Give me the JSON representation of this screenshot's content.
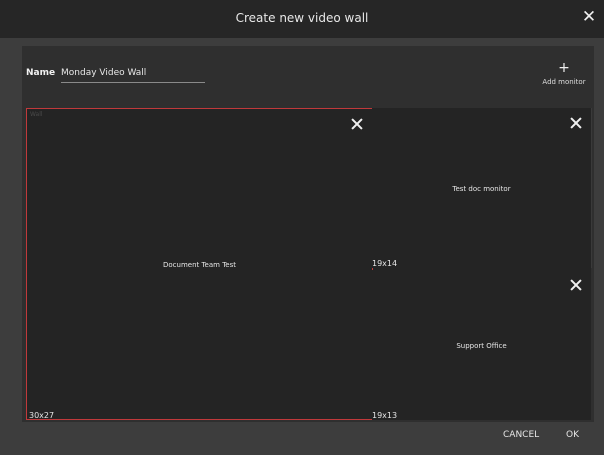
{
  "dialog": {
    "title": "Create new video wall",
    "close_icon": "close-icon"
  },
  "form": {
    "name_label": "Name",
    "name_value": "Monday Video Wall",
    "add_monitor": {
      "icon": "+",
      "label": "Add monitor"
    }
  },
  "wall": {
    "label": "Wall",
    "monitors": [
      {
        "name": "Document Team Test",
        "size": "30x27",
        "selected": true
      },
      {
        "name": "Test doc monitor",
        "size": "19x14",
        "selected": false
      },
      {
        "name": "Support Office",
        "size": "19x13",
        "selected": false
      }
    ]
  },
  "actions": {
    "cancel": "CANCEL",
    "ok": "OK"
  },
  "colors": {
    "selected_border": "#c0393b",
    "titlebar_bg": "#262626",
    "monitor_bg": "#242424"
  }
}
